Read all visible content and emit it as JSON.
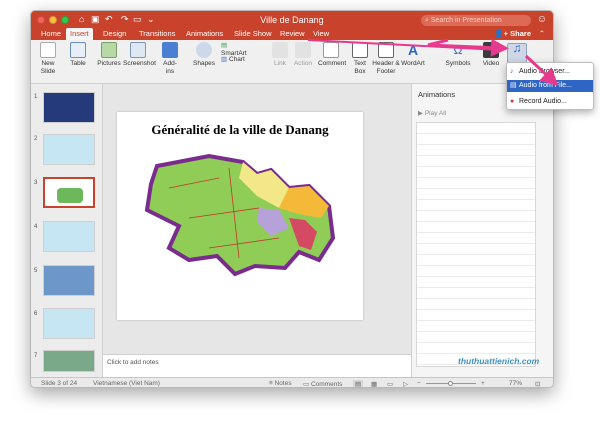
{
  "app": {
    "window_title": "Ville de Danang",
    "search_placeholder": "Search in Presentation",
    "share_label": "Share",
    "collapse_icon": "chevron-up-icon"
  },
  "tabs": [
    {
      "label": "Home"
    },
    {
      "label": "Insert",
      "active": true
    },
    {
      "label": "Design"
    },
    {
      "label": "Transitions"
    },
    {
      "label": "Animations"
    },
    {
      "label": "Slide Show"
    },
    {
      "label": "Review"
    },
    {
      "label": "View"
    }
  ],
  "ribbon": [
    {
      "label": "New\nSlide",
      "icon": "new-slide-icon"
    },
    {
      "label": "Table",
      "icon": "table-icon"
    },
    {
      "label": "Pictures",
      "icon": "pictures-icon"
    },
    {
      "label": "Screenshot",
      "icon": "screenshot-icon"
    },
    {
      "label": "Add-ins",
      "icon": "addins-icon"
    },
    {
      "label": "Shapes",
      "icon": "shapes-icon"
    },
    {
      "label": "SmartArt",
      "icon": "smartart-icon"
    },
    {
      "label": "Chart",
      "icon": "chart-icon"
    },
    {
      "label": "Link",
      "icon": "link-icon"
    },
    {
      "label": "Action",
      "icon": "action-icon"
    },
    {
      "label": "Comment",
      "icon": "comment-icon"
    },
    {
      "label": "Text\nBox",
      "icon": "textbox-icon"
    },
    {
      "label": "Header &\nFooter",
      "icon": "header-footer-icon"
    },
    {
      "label": "WordArt",
      "icon": "wordart-icon"
    },
    {
      "label": "Symbols",
      "icon": "symbols-icon"
    },
    {
      "label": "Video",
      "icon": "video-icon"
    }
  ],
  "audio_menu": [
    {
      "label": "Audio Browser...",
      "display": "Audio Browser..."
    },
    {
      "label": "Audio from File...",
      "highlighted": true
    },
    {
      "label": "Record Audio..."
    }
  ],
  "thumbnails": [
    {
      "number": "1"
    },
    {
      "number": "2"
    },
    {
      "number": "3",
      "selected": true
    },
    {
      "number": "4"
    },
    {
      "number": "5"
    },
    {
      "number": "6"
    },
    {
      "number": "7"
    }
  ],
  "slide": {
    "title": "Généralité de la ville de Danang"
  },
  "notes": {
    "placeholder": "Click to add notes"
  },
  "animations_pane": {
    "title": "Animations",
    "play_label": "Play All"
  },
  "status": {
    "slide_info": "Slide 3 of 24",
    "language": "Vietnamese (Viet Nam)",
    "notes_label": "Notes",
    "comments_label": "Comments",
    "zoom": "77%"
  },
  "watermark": "thuthuattienich.com",
  "colors": {
    "brand": "#c9432c",
    "menu_highlight": "#2f66c6",
    "arrow": "#e53a8e"
  }
}
